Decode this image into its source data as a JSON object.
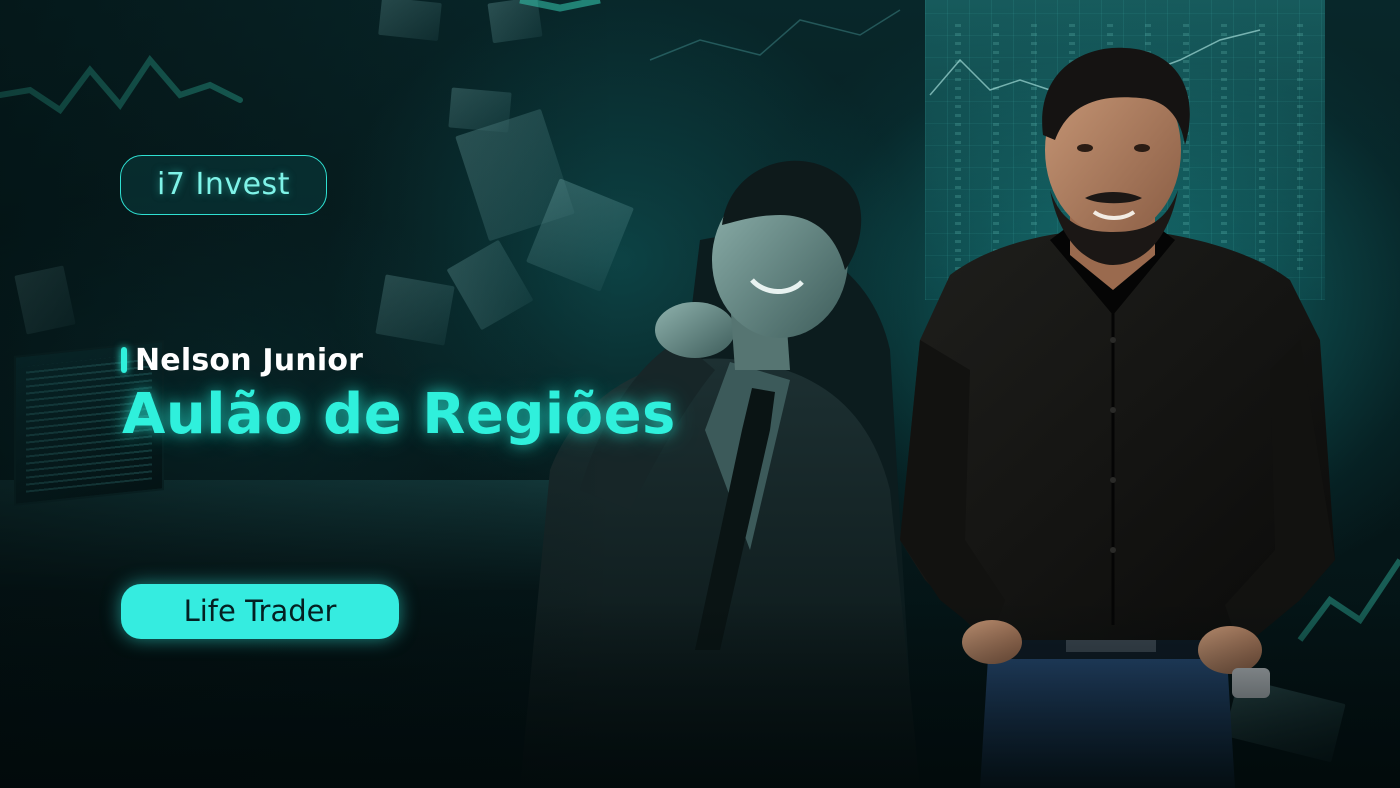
{
  "brand": {
    "label": "i7 Invest"
  },
  "presenter": {
    "name": "Nelson Junior"
  },
  "headline": {
    "title": "Aulão de Regiões"
  },
  "tag": {
    "label": "Life Trader"
  },
  "colors": {
    "accent": "#2ff0dc",
    "pill_fill": "#35ece0",
    "background": "#06191b",
    "text_light": "#ffffff"
  }
}
